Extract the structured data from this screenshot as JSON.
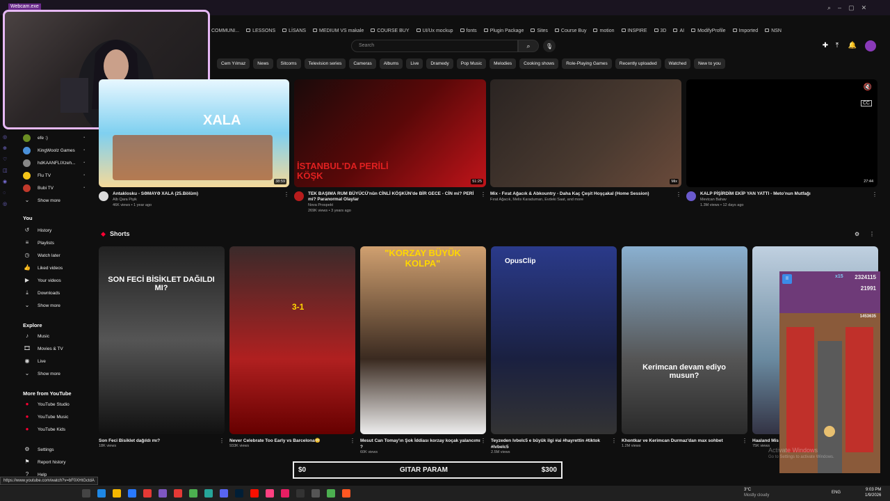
{
  "browser": {
    "tab_title": "Webcam.exe",
    "status_url": "https://www.youtube.com/watch?v=bF0XHtGctdA"
  },
  "bookmarks": [
    "COMMUNI...",
    "LESSONS",
    "LİSANS",
    "MEDIUM VS makale",
    "COURSE BUY",
    "UI/Ux mockup",
    "fonts",
    "Plugin Package",
    "Sites",
    "Course Buy",
    "motion",
    "INSPIRE",
    "3D",
    "AI",
    "ModifyProfile",
    "Imported",
    "NSN"
  ],
  "search": {
    "placeholder": "Search"
  },
  "chips": [
    "Cem Yılmaz",
    "News",
    "Sitcoms",
    "Television series",
    "Cameras",
    "Albums",
    "Live",
    "Dramedy",
    "Pop Music",
    "Melodies",
    "Cooking shows",
    "Role-Playing Games",
    "Recently uploaded",
    "Watched",
    "New to you"
  ],
  "sidebar": {
    "channels": [
      {
        "name": "efe :)",
        "color": "#6b8e23"
      },
      {
        "name": "KingWoolz Games",
        "color": "#4a90d9"
      },
      {
        "name": "hdKAANFLIXzeh...",
        "color": "#888"
      },
      {
        "name": "Flu TV",
        "color": "#f5c518"
      },
      {
        "name": "Bubi TV",
        "color": "#c0392b"
      }
    ],
    "channels_more": "Show more",
    "you_header": "You",
    "you": [
      {
        "label": "History",
        "icon": "history-icon",
        "glyph": "↺"
      },
      {
        "label": "Playlists",
        "icon": "playlists-icon",
        "glyph": "≡"
      },
      {
        "label": "Watch later",
        "icon": "clock-icon",
        "glyph": "◷"
      },
      {
        "label": "Liked videos",
        "icon": "thumbs-up-icon",
        "glyph": "👍"
      },
      {
        "label": "Your videos",
        "icon": "video-icon",
        "glyph": "▶"
      },
      {
        "label": "Downloads",
        "icon": "download-icon",
        "glyph": "⤓"
      },
      {
        "label": "Show more",
        "icon": "chevron-down-icon",
        "glyph": "⌄"
      }
    ],
    "explore_header": "Explore",
    "explore": [
      {
        "label": "Music",
        "icon": "music-icon",
        "glyph": "♪"
      },
      {
        "label": "Movies & TV",
        "icon": "film-icon",
        "glyph": "🎞"
      },
      {
        "label": "Live",
        "icon": "live-icon",
        "glyph": "◉"
      },
      {
        "label": "Show more",
        "icon": "chevron-down-icon",
        "glyph": "⌄"
      }
    ],
    "more_header": "More from YouTube",
    "more": [
      {
        "label": "YouTube Studio"
      },
      {
        "label": "YouTube Music"
      },
      {
        "label": "YouTube Kids"
      }
    ],
    "bottom": [
      {
        "label": "Settings",
        "icon": "gear-icon",
        "glyph": "⚙"
      },
      {
        "label": "Report history",
        "icon": "flag-icon",
        "glyph": "⚑"
      },
      {
        "label": "Help",
        "icon": "help-icon",
        "glyph": "?"
      }
    ]
  },
  "videos": [
    {
      "title": "Antaklosku - SƏMAYƏ XALA (25.Bölüm)",
      "channel": "Alb Qara Pişik",
      "meta": "46K views • 1 year ago",
      "duration": "38:59",
      "thumb_text": "XALA"
    },
    {
      "title": "TEK BAŞIMA RUM BÜYÜCÜ'nün CİNLİ KÖŞKÜN'de BİR GECE - CİN mi? PERİ mi? Paranormal Olaylar",
      "channel": "Nova Prospekt",
      "meta": "269K views • 3 years ago",
      "duration": "51:25",
      "thumb_text": "İSTANBUL'DA PERİLİ KÖŞK"
    },
    {
      "title": "Mix - Fırat Ağacık & Abkountry - Daha Kaç Çeşit Hoşçakal (Home Session)",
      "channel": "Fırat Ağacık, Melis Karaduman, Evdeki Saat, and more",
      "meta": "",
      "duration": "Mix",
      "thumb_text": ""
    },
    {
      "title": "KALP PİŞİRDİM EKİP YAN YATTI - Meto'nun Mutfağı",
      "channel": "Mevtcan Bahav",
      "meta": "1.3M views • 12 days ago",
      "duration": "27:44",
      "thumb_text": ""
    }
  ],
  "shorts_header": "Shorts",
  "shorts": [
    {
      "title": "Son Feci Bisiklet dağıldı mı?",
      "views": "18K views",
      "overlay": "SON FECİ BİSİKLET DAĞILDI MI?"
    },
    {
      "title": "Never Celebrate Too Early vs Barcelona😳",
      "views": "933K views",
      "overlay": "3-1"
    },
    {
      "title": "Mesut Can Tomay'ın Şok İddiası korzay koçak yalancımı ?",
      "views": "60K views",
      "overlay": "\"KORZAY BÜYÜK KOLPA\""
    },
    {
      "title": "Teyzeden lvbelc5 e büyük ilgi #ai #hayrettin #tiktok #lvbelc5",
      "views": "2.5M views",
      "overlay": "OpusClip"
    },
    {
      "title": "Khontkar ve Kerimcan Durmaz'dan max sohbet",
      "views": "1.2M views",
      "overlay": "Kerimcan devam ediyo musun?"
    },
    {
      "title": "Haaland Mis",
      "views": "75K views",
      "overlay": ""
    }
  ],
  "overlay_bar": {
    "left": "$0",
    "center": "GITAR PARAM",
    "right": "$300"
  },
  "game": {
    "score": "2324115",
    "coins": "21991",
    "multiplier": "x15",
    "hiscore": "1453635"
  },
  "watermark": {
    "line1": "Activate Windows",
    "line2": "Go to Settings to activate Windows."
  },
  "taskbar": {
    "weather": "3°C",
    "weather_desc": "Mostly cloudy",
    "lang": "ENG",
    "time": "9:03 PM",
    "date": "1/9/2026"
  },
  "colors": {
    "bg": "#0f0f0f",
    "accent": "#ff0000",
    "webcam_border": "#e6b8f5"
  }
}
